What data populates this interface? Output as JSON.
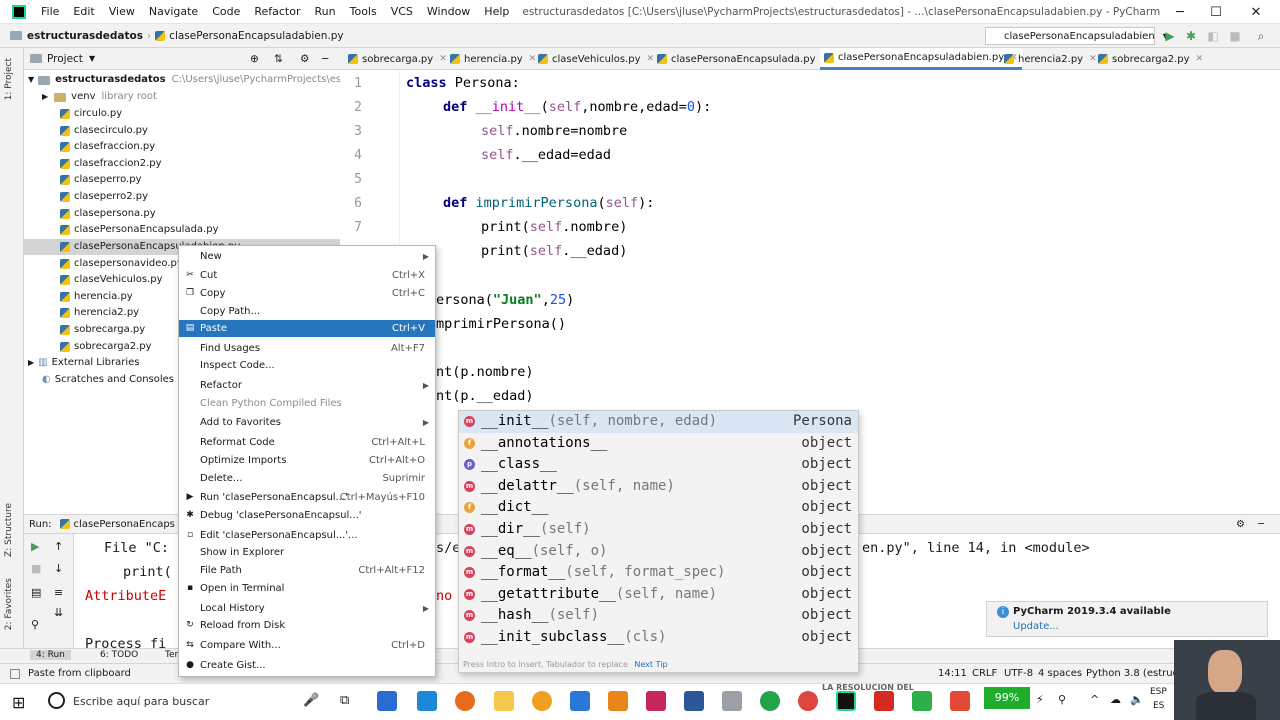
{
  "window": {
    "title": "estructurasdedatos [C:\\Users\\jluse\\PycharmProjects\\estructurasdedatos] - ...\\clasePersonaEncapsuladabien.py - PyCharm",
    "menu": [
      "File",
      "Edit",
      "View",
      "Navigate",
      "Code",
      "Refactor",
      "Run",
      "Tools",
      "VCS",
      "Window",
      "Help"
    ]
  },
  "navbar": {
    "project": "estructurasdedatos",
    "file": "clasePersonaEncapsuladabien.py",
    "run_config": "clasePersonaEncapsuladabien"
  },
  "project_panel": {
    "header": "Project",
    "root": "estructurasdedatos",
    "root_path": "C:\\Users\\jluse\\PycharmProjects\\estructuras",
    "venv": "venv",
    "venv_hint": "library root",
    "files": [
      "circulo.py",
      "clasecirculo.py",
      "clasefraccion.py",
      "clasefraccion2.py",
      "claseperro.py",
      "claseperro2.py",
      "clasepersona.py",
      "clasePersonaEncapsulada.py",
      "clasePersonaEncapsuladabien.py",
      "clasepersonavideo.py",
      "claseVehiculos.py",
      "herencia.py",
      "herencia2.py",
      "sobrecarga.py",
      "sobrecarga2.py"
    ],
    "external": "External Libraries",
    "scratches": "Scratches and Consoles"
  },
  "tabs": [
    "sobrecarga.py",
    "herencia.py",
    "claseVehiculos.py",
    "clasePersonaEncapsulada.py",
    "clasePersonaEncapsuladabien.py",
    "herencia2.py",
    "sobrecarga2.py"
  ],
  "editor": {
    "line_numbers": [
      "1",
      "2",
      "3",
      "4",
      "5",
      "6",
      "7"
    ],
    "l1_kw": "class",
    "l1_name": " Persona:",
    "l2_kw": "def",
    "l2_fn": "__init__",
    "l2_open": "(",
    "l2_self": "self",
    "l2_rest": ",nombre,edad=",
    "l2_num": "0",
    "l2_close": "):",
    "l3_self": "self",
    "l3_rest": ".nombre=nombre",
    "l4_self": "self",
    "l4_rest": ".__edad=edad",
    "l6_kw": "def",
    "l6_fn": "imprimirPersona",
    "l6_open": "(",
    "l6_self": "self",
    "l6_close": "):",
    "l7_a": "print(",
    "l7_self": "self",
    "l7_b": ".nombre)",
    "l8_a": "print(",
    "l8_self": "self",
    "l8_b": ".__edad)",
    "l10_a": "ersona(",
    "l10_str": "\"Juan\"",
    "l10_b": ",",
    "l10_num": "25",
    "l10_c": ")",
    "l11": "mprimirPersona()",
    "l13": "nt(p.nombre)",
    "l14": "nt(p.__edad)"
  },
  "context_menu": {
    "items": [
      {
        "label": "New",
        "shortcut": "",
        "icon": "",
        "submenu": true
      },
      {
        "label": "Cut",
        "shortcut": "Ctrl+X",
        "icon": "✂"
      },
      {
        "label": "Copy",
        "shortcut": "Ctrl+C",
        "icon": "❐"
      },
      {
        "label": "Copy Path...",
        "shortcut": "",
        "icon": ""
      },
      {
        "label": "Paste",
        "shortcut": "Ctrl+V",
        "icon": "▤",
        "selected": true
      },
      {
        "label": "Find Usages",
        "shortcut": "Alt+F7",
        "icon": ""
      },
      {
        "label": "Inspect Code...",
        "shortcut": "",
        "icon": ""
      },
      {
        "label": "Refactor",
        "shortcut": "",
        "icon": "",
        "submenu": true
      },
      {
        "label": "Clean Python Compiled Files",
        "shortcut": "",
        "icon": "",
        "disabled": true
      },
      {
        "label": "Add to Favorites",
        "shortcut": "",
        "icon": "",
        "submenu": true
      },
      {
        "label": "Reformat Code",
        "shortcut": "Ctrl+Alt+L",
        "icon": ""
      },
      {
        "label": "Optimize Imports",
        "shortcut": "Ctrl+Alt+O",
        "icon": ""
      },
      {
        "label": "Delete...",
        "shortcut": "Suprimir",
        "icon": ""
      },
      {
        "label": "Run 'clasePersonaEncapsul...'",
        "shortcut": "Ctrl+Mayús+F10",
        "icon": "▶"
      },
      {
        "label": "Debug 'clasePersonaEncapsul...'",
        "shortcut": "",
        "icon": "✱"
      },
      {
        "label": "Edit 'clasePersonaEncapsul...'...",
        "shortcut": "",
        "icon": "▫"
      },
      {
        "label": "Show in Explorer",
        "shortcut": "",
        "icon": ""
      },
      {
        "label": "File Path",
        "shortcut": "Ctrl+Alt+F12",
        "icon": ""
      },
      {
        "label": "Open in Terminal",
        "shortcut": "",
        "icon": "▪"
      },
      {
        "label": "Local History",
        "shortcut": "",
        "icon": "",
        "submenu": true
      },
      {
        "label": "Reload from Disk",
        "shortcut": "",
        "icon": "↻"
      },
      {
        "label": "Compare With...",
        "shortcut": "Ctrl+D",
        "icon": "⇆"
      },
      {
        "label": "Create Gist...",
        "shortcut": "",
        "icon": "●"
      }
    ]
  },
  "completion": {
    "items": [
      {
        "badge": "m",
        "name": "__init__",
        "args": "(self, nombre, edad)",
        "type": "Persona",
        "selected": true
      },
      {
        "badge": "f",
        "name": "__annotations__",
        "args": "",
        "type": "object"
      },
      {
        "badge": "p",
        "name": "__class__",
        "args": "",
        "type": "object"
      },
      {
        "badge": "m",
        "name": "__delattr__",
        "args": "(self, name)",
        "type": "object"
      },
      {
        "badge": "f",
        "name": "__dict__",
        "args": "",
        "type": "object"
      },
      {
        "badge": "m",
        "name": "__dir__",
        "args": "(self)",
        "type": "object"
      },
      {
        "badge": "m",
        "name": "__eq__",
        "args": "(self, o)",
        "type": "object"
      },
      {
        "badge": "m",
        "name": "__format__",
        "args": "(self, format_spec)",
        "type": "object"
      },
      {
        "badge": "m",
        "name": "__getattribute__",
        "args": "(self, name)",
        "type": "object"
      },
      {
        "badge": "m",
        "name": "__hash__",
        "args": "(self)",
        "type": "object"
      },
      {
        "badge": "m",
        "name": "__init_subclass__",
        "args": "(cls)",
        "type": "object"
      }
    ],
    "footer": "Press Intro to insert, Tabulador to replace",
    "footer_link": "Next Tip"
  },
  "run_panel": {
    "label": "Run:",
    "tab": "clasePersonaEncaps",
    "line1": "File \"C:",
    "line1_tail_a": "s/e",
    "line1_tail_b": "en.py\", line 14, in <module>",
    "line2": "print(",
    "line3": "AttributeE",
    "line3_tail": "no",
    "line4": "Process fi"
  },
  "bottom_tabs": {
    "run": "4: Run",
    "todo": "6: TODO",
    "ter": "Ter"
  },
  "status": {
    "message": "Paste from clipboard",
    "position": "14:11",
    "line_sep": "CRLF",
    "encoding": "UTF-8",
    "indent": "4 spaces",
    "interpreter": "Python 3.8 (estructu"
  },
  "notification": {
    "title": "PyCharm 2019.3.4 available",
    "link": "Update..."
  },
  "taskbar": {
    "search": "Escribe aquí para buscar",
    "battery": "99%",
    "lang1": "ESP",
    "lang2": "ES",
    "caption": "LA RESOLUCION DEL"
  },
  "vertical_tabs": {
    "project": "1: Project",
    "structure": "Z: Structure",
    "favorites": "2: Favorites"
  }
}
